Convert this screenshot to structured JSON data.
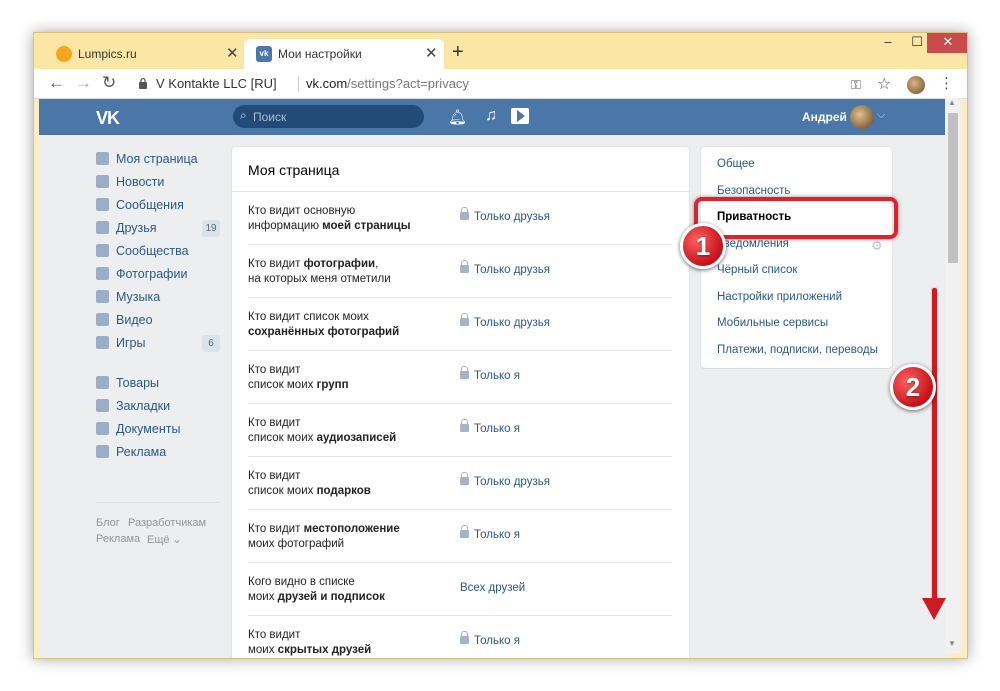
{
  "browser": {
    "tabs": [
      {
        "label": "Lumpics.ru",
        "close": "✕"
      },
      {
        "label": "Мои настройки",
        "close": "✕"
      }
    ],
    "new_tab": "+",
    "window_controls": {
      "minimize": "‒",
      "maximize": "☐",
      "close": "✕"
    },
    "site_name": "V Kontakte LLC [RU]",
    "url_host": "vk.com",
    "url_path": "/settings?act=privacy",
    "icons": [
      "back-arrow-icon",
      "forward-arrow-icon",
      "reload-icon",
      "lock-icon",
      "key-icon",
      "star-icon",
      "kebab-menu-icon"
    ]
  },
  "vk": {
    "logo": "VK",
    "search_placeholder": "Поиск",
    "user_name": "Андрей",
    "left_menu": [
      {
        "label": "Моя страница",
        "icon": "home-icon"
      },
      {
        "label": "Новости",
        "icon": "news-icon"
      },
      {
        "label": "Сообщения",
        "icon": "messages-icon"
      },
      {
        "label": "Друзья",
        "icon": "friends-icon",
        "count": "19"
      },
      {
        "label": "Сообщества",
        "icon": "communities-icon"
      },
      {
        "label": "Фотографии",
        "icon": "photos-icon"
      },
      {
        "label": "Музыка",
        "icon": "music-icon"
      },
      {
        "label": "Видео",
        "icon": "video-icon"
      },
      {
        "label": "Игры",
        "icon": "games-icon",
        "count": "6"
      },
      {
        "label": "Товары",
        "icon": "goods-icon"
      },
      {
        "label": "Закладки",
        "icon": "bookmarks-icon"
      },
      {
        "label": "Документы",
        "icon": "documents-icon"
      },
      {
        "label": "Реклама",
        "icon": "ads-icon"
      }
    ],
    "footer_links": [
      "Блог",
      "Разработчикам",
      "Реклама",
      "Ещё ⌄"
    ]
  },
  "privacy": {
    "section_title": "Моя страница",
    "rows": [
      {
        "q1": "Кто видит основную",
        "q2": "информацию ",
        "q2b": "моей страницы",
        "value": "Только друзья",
        "lock": true
      },
      {
        "q1": "Кто видит ",
        "q1b": "фотографии",
        "q1c": ",",
        "q2": "на которых меня отметили",
        "value": "Только друзья",
        "lock": true
      },
      {
        "q1": "Кто видит список моих",
        "q2": "",
        "q2b": "сохранённых фотографий",
        "value": "Только друзья",
        "lock": true
      },
      {
        "q1": "Кто видит",
        "q2": "список моих ",
        "q2b": "групп",
        "value": "Только я",
        "lock": true
      },
      {
        "q1": "Кто видит",
        "q2": "список моих ",
        "q2b": "аудиозаписей",
        "value": "Только я",
        "lock": true
      },
      {
        "q1": "Кто видит",
        "q2": "список моих ",
        "q2b": "подарков",
        "value": "Только друзья",
        "lock": true
      },
      {
        "q1": "Кто видит ",
        "q1b": "местоположение",
        "q2": "моих фотографий",
        "value": "Только я",
        "lock": true
      },
      {
        "q1": "Кого видно в списке",
        "q2": "моих ",
        "q2b": "друзей и подписок",
        "value": "Всех друзей",
        "lock": false
      },
      {
        "q1": "Кто видит",
        "q2": "моих ",
        "q2b": "скрытых друзей",
        "value": "Только я",
        "lock": true
      }
    ]
  },
  "settings_menu": {
    "items": [
      "Общее",
      "Безопасность",
      "Приватность",
      "Уведомления",
      "Чёрный список",
      "Настройки приложений",
      "Мобильные сервисы",
      "Платежи, подписки, переводы"
    ],
    "active": "Приватность"
  },
  "annotations": {
    "step1": "1",
    "step2": "2",
    "highlight_color": "#e0202a"
  },
  "colors": {
    "vk_header": "#4a76a8",
    "link": "#2a5885",
    "page_bg": "#edeef0"
  }
}
